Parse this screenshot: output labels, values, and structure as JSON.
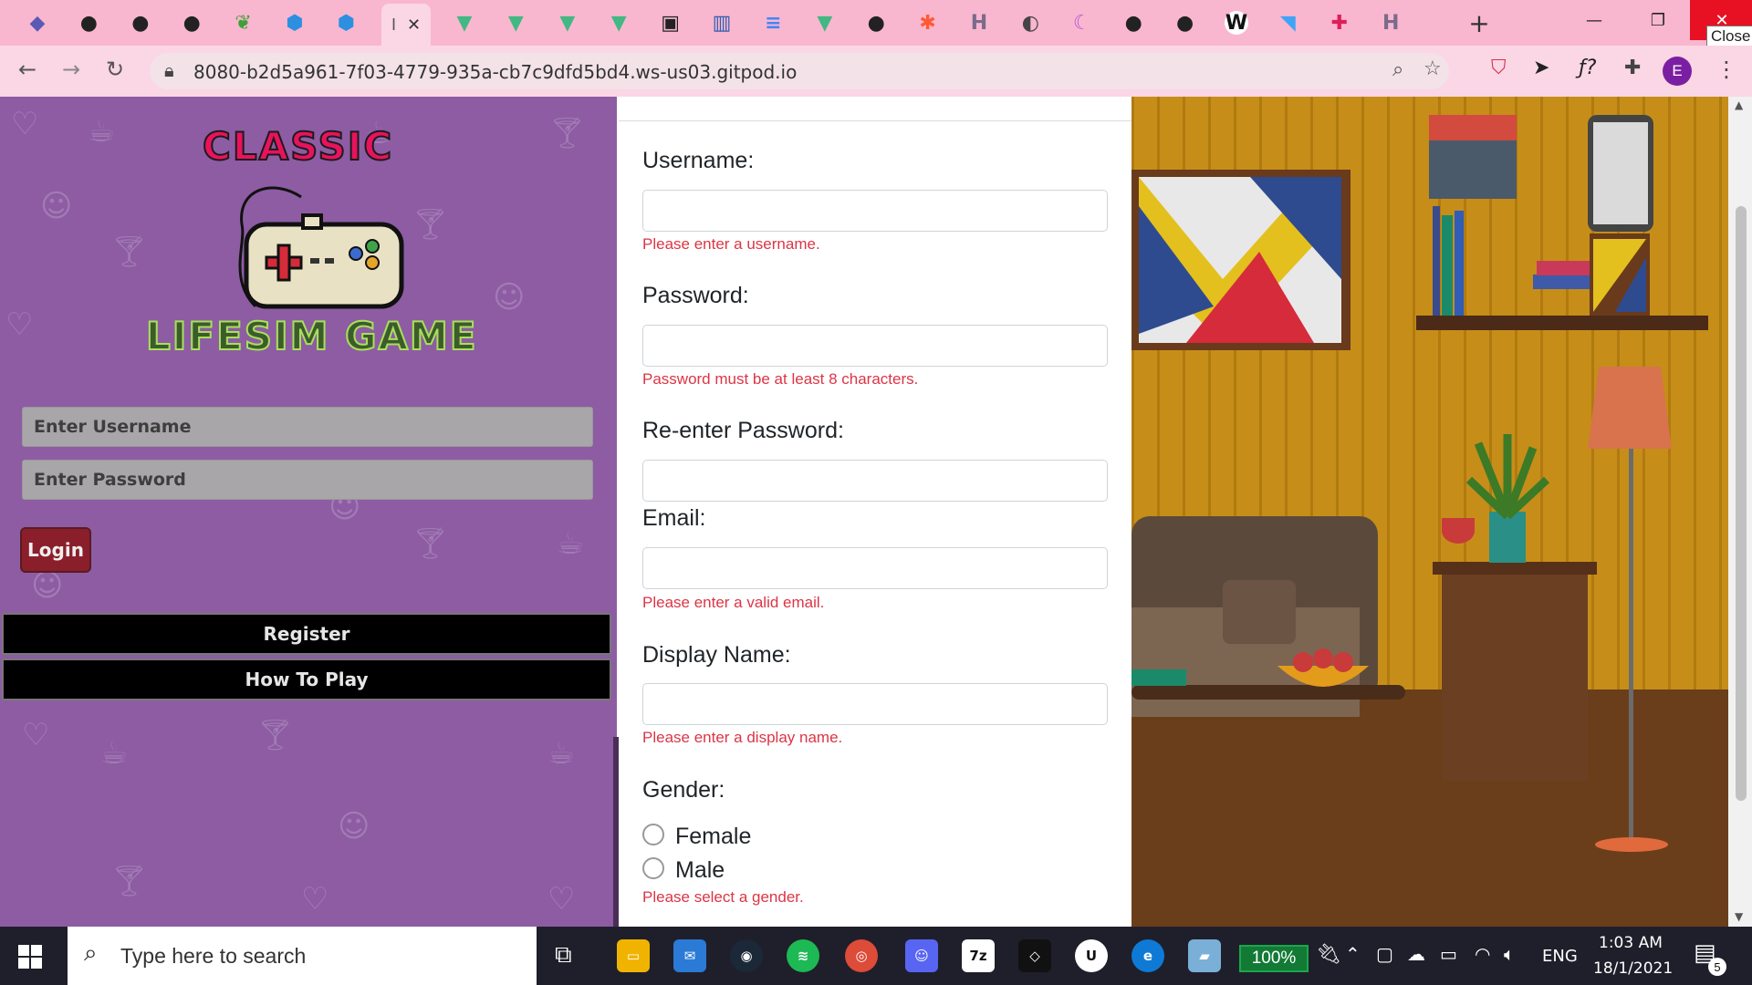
{
  "browser": {
    "url": "8080-b2d5a961-7f03-4779-935a-cb7c9dfd5bd4.ws-us03.gitpod.io",
    "active_tab_label": "I",
    "close_tooltip": "Close",
    "profile_initial": "E",
    "tabs": [
      {
        "icon": "vscode-icon",
        "color": "#5a5ab5"
      },
      {
        "icon": "github-icon",
        "color": "#222"
      },
      {
        "icon": "github-icon",
        "color": "#222"
      },
      {
        "icon": "github-icon",
        "color": "#222"
      },
      {
        "icon": "mongodb-leaf-icon",
        "color": "#3fa037"
      },
      {
        "icon": "hexagon-icon",
        "color": "#2d8fe0"
      },
      {
        "icon": "hexagon-icon",
        "color": "#2d8fe0"
      },
      {
        "icon": "vue-icon",
        "color": "#42b883"
      },
      {
        "icon": "vue-icon",
        "color": "#42b883"
      },
      {
        "icon": "vue-icon",
        "color": "#42b883"
      },
      {
        "icon": "vue-icon",
        "color": "#42b883"
      },
      {
        "icon": "vue-icon",
        "color": "#42b883"
      },
      {
        "icon": "pic-icon",
        "color": "#222"
      },
      {
        "icon": "chart-icon",
        "color": "#2b5fb0"
      },
      {
        "icon": "docs-icon",
        "color": "#4285f4"
      },
      {
        "icon": "vue-icon",
        "color": "#42b883"
      },
      {
        "icon": "github-icon",
        "color": "#222"
      },
      {
        "icon": "asterisk-icon",
        "color": "#ff5a36"
      },
      {
        "icon": "h-icon",
        "color": "#7b6b8a"
      },
      {
        "icon": "globe-icon",
        "color": "#444"
      },
      {
        "icon": "moon-icon",
        "color": "#b05cd8"
      },
      {
        "icon": "github-icon",
        "color": "#222"
      },
      {
        "icon": "github-icon",
        "color": "#222"
      },
      {
        "icon": "wikipedia-icon",
        "color": "#fff"
      },
      {
        "icon": "flutter-icon",
        "color": "#3fa4f5"
      },
      {
        "icon": "slack-icon",
        "color": "#e01e5a"
      },
      {
        "icon": "h-icon",
        "color": "#7b6b8a"
      }
    ]
  },
  "left": {
    "logo_top": "CLASSIC",
    "logo_bottom": "LIFESIM GAME",
    "username_placeholder": "Enter Username",
    "password_placeholder": "Enter Password",
    "login_label": "Login",
    "register_label": "Register",
    "howto_label": "How To Play"
  },
  "form": {
    "username_label": "Username:",
    "username_error": "Please enter a username.",
    "password_label": "Password:",
    "password_error": "Password must be at least 8 characters.",
    "repassword_label": "Re-enter Password:",
    "email_label": "Email:",
    "email_error": "Please enter a valid email.",
    "display_label": "Display Name:",
    "display_error": "Please enter a display name.",
    "gender_label": "Gender:",
    "gender_options": [
      "Female",
      "Male"
    ],
    "gender_error": "Please select a gender."
  },
  "taskbar": {
    "search_placeholder": "Type here to search",
    "battery": "100%",
    "language": "ENG",
    "time": "1:03 AM",
    "date": "18/1/2021",
    "notifications": "5"
  },
  "colors": {
    "tabbar": "#f9b6cf",
    "left_panel": "#8d5ca3",
    "error": "#dc3545",
    "scene_wall": "#c18a17"
  }
}
